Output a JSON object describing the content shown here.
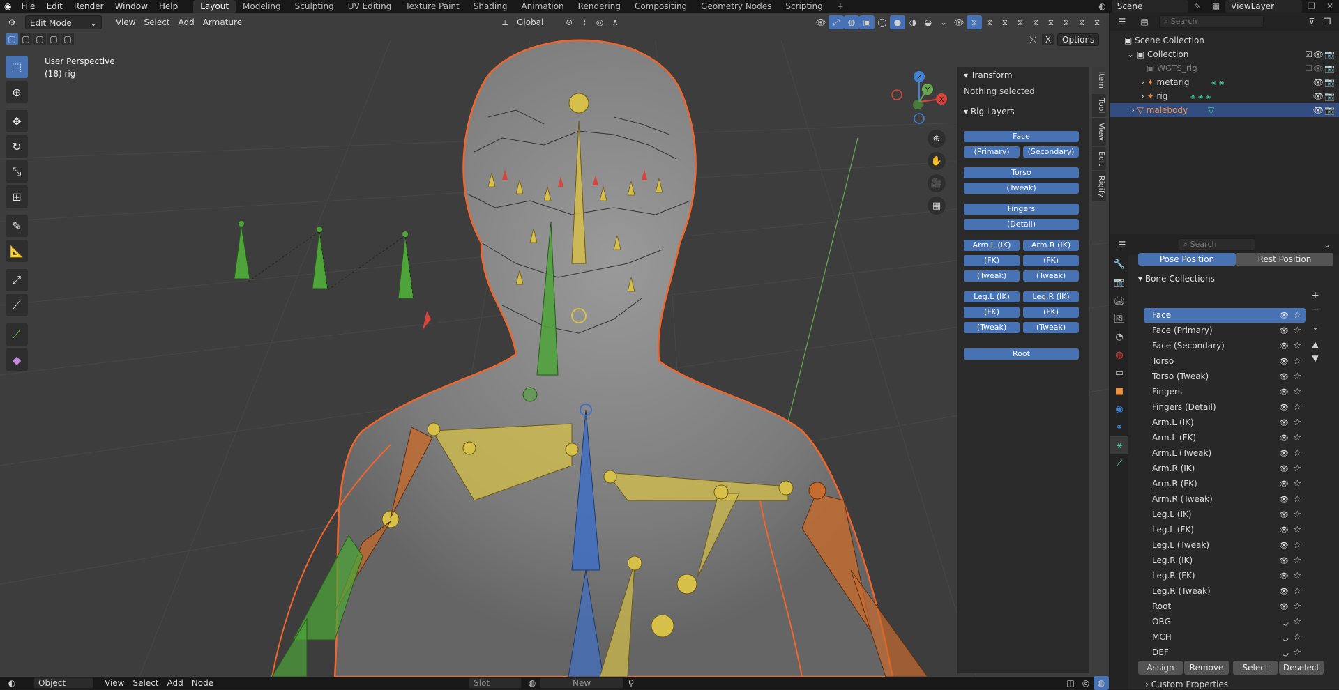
{
  "topbar": {
    "menus": [
      "File",
      "Edit",
      "Render",
      "Window",
      "Help"
    ],
    "workspaces": [
      "Layout",
      "Modeling",
      "Sculpting",
      "UV Editing",
      "Texture Paint",
      "Shading",
      "Animation",
      "Rendering",
      "Compositing",
      "Geometry Nodes",
      "Scripting"
    ],
    "active_workspace": "Layout",
    "scene": "Scene",
    "view_layer": "ViewLayer"
  },
  "viewport": {
    "mode": "Edit Mode",
    "menus": [
      "View",
      "Select",
      "Add",
      "Armature"
    ],
    "orientation": "Global",
    "options_label": "Options",
    "overlay_title": "User Perspective",
    "overlay_subtitle": "(18) rig",
    "gizmo_axes": {
      "z": "Z",
      "y": "Y",
      "x": "X"
    }
  },
  "n_panel": {
    "tabs": [
      "Item",
      "Tool",
      "View",
      "Edit",
      "Rigify"
    ],
    "transform_title": "Transform",
    "transform_text": "Nothing selected",
    "rig_layers_title": "Rig Layers",
    "buttons": {
      "face": "Face",
      "face_primary": "(Primary)",
      "face_secondary": "(Secondary)",
      "torso": "Torso",
      "torso_tweak": "(Tweak)",
      "fingers": "Fingers",
      "fingers_detail": "(Detail)",
      "arm_l_ik": "Arm.L (IK)",
      "arm_r_ik": "Arm.R (IK)",
      "arm_l_fk": "(FK)",
      "arm_r_fk": "(FK)",
      "arm_l_tweak": "(Tweak)",
      "arm_r_tweak": "(Tweak)",
      "leg_l_ik": "Leg.L (IK)",
      "leg_r_ik": "Leg.R (IK)",
      "leg_l_fk": "(FK)",
      "leg_r_fk": "(FK)",
      "leg_l_tweak": "(Tweak)",
      "leg_r_tweak": "(Tweak)",
      "root": "Root"
    }
  },
  "outliner": {
    "search_placeholder": "Search",
    "rows": [
      {
        "label": "Scene Collection"
      },
      {
        "label": "Collection"
      },
      {
        "label": "WGTS_rig"
      },
      {
        "label": "metarig"
      },
      {
        "label": "rig"
      },
      {
        "label": "malebody"
      }
    ]
  },
  "properties": {
    "search_placeholder": "Search",
    "pose_position": "Pose Position",
    "rest_position": "Rest Position",
    "bone_collections_title": "Bone Collections",
    "collections": [
      {
        "label": "Face",
        "visible": true
      },
      {
        "label": "Face (Primary)",
        "visible": true
      },
      {
        "label": "Face (Secondary)",
        "visible": true
      },
      {
        "label": "Torso",
        "visible": true
      },
      {
        "label": "Torso (Tweak)",
        "visible": true
      },
      {
        "label": "Fingers",
        "visible": true
      },
      {
        "label": "Fingers (Detail)",
        "visible": true
      },
      {
        "label": "Arm.L (IK)",
        "visible": true
      },
      {
        "label": "Arm.L (FK)",
        "visible": true
      },
      {
        "label": "Arm.L (Tweak)",
        "visible": true
      },
      {
        "label": "Arm.R (IK)",
        "visible": true
      },
      {
        "label": "Arm.R (FK)",
        "visible": true
      },
      {
        "label": "Arm.R (Tweak)",
        "visible": true
      },
      {
        "label": "Leg.L (IK)",
        "visible": true
      },
      {
        "label": "Leg.L (FK)",
        "visible": true
      },
      {
        "label": "Leg.L (Tweak)",
        "visible": true
      },
      {
        "label": "Leg.R (IK)",
        "visible": true
      },
      {
        "label": "Leg.R (FK)",
        "visible": true
      },
      {
        "label": "Leg.R (Tweak)",
        "visible": true
      },
      {
        "label": "Root",
        "visible": true
      },
      {
        "label": "ORG",
        "visible": false
      },
      {
        "label": "MCH",
        "visible": false
      },
      {
        "label": "DEF",
        "visible": false
      }
    ],
    "assign": "Assign",
    "remove": "Remove",
    "select": "Select",
    "deselect": "Deselect",
    "custom_properties": "Custom Properties"
  },
  "bottom_bar": {
    "editor_mode": "Object",
    "menus": [
      "View",
      "Select",
      "Add",
      "Node"
    ],
    "slot_label": "Slot",
    "new_label": "New"
  },
  "colors": {
    "accent": "#4772b3",
    "selection_outline": "#f0662b",
    "bone_yellow": "#d6c04a",
    "bone_green": "#4ea33a",
    "bone_blue": "#3f6fc4",
    "bone_orange": "#c76b2e"
  }
}
